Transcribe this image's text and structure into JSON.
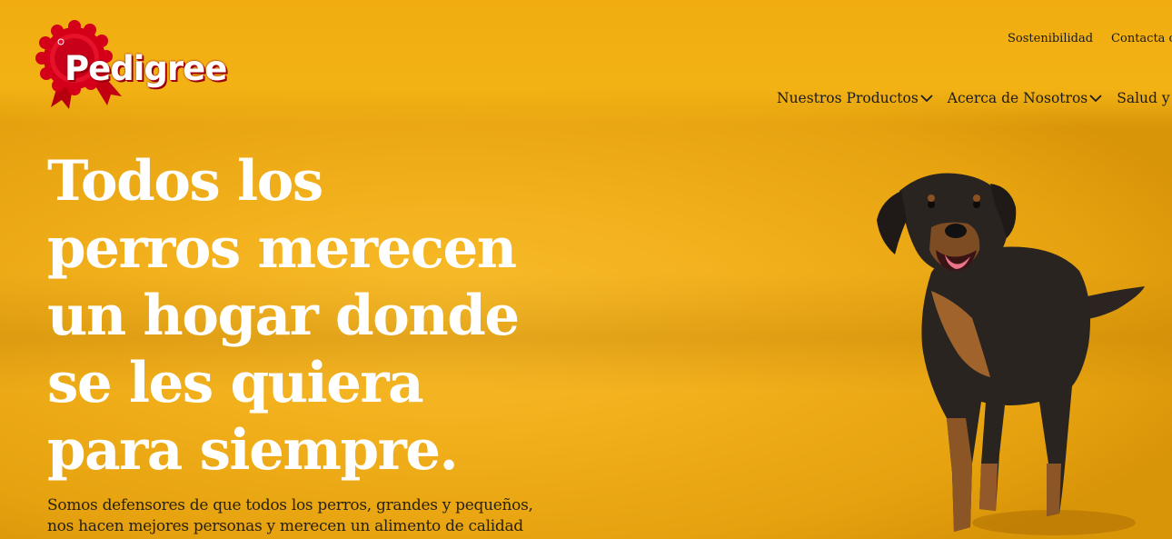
{
  "brand": {
    "logo_text": "Pedigree",
    "colors": {
      "background": "#f2b01c",
      "logo_red": "#d4001a",
      "headline": "#ffffff",
      "text": "#1a1a1a"
    }
  },
  "utility_nav": {
    "items": [
      "Sostenibilidad",
      "Contacta con"
    ]
  },
  "main_nav": {
    "items": [
      {
        "label": "Nuestros Productos",
        "icon": "chevron-down-icon"
      },
      {
        "label": "Acerca de Nosotros",
        "icon": "chevron-down-icon"
      },
      {
        "label": "Salud y Cuidad",
        "icon": null
      }
    ]
  },
  "hero": {
    "headline": "Todos los\nperros merecen\nun hogar donde\nse les quiera\npara siempre.",
    "intro": "Somos defensores de que todos los perros, grandes y pequeños, nos hacen mejores personas y merecen un alimento de calidad",
    "image": "dog-photo"
  }
}
